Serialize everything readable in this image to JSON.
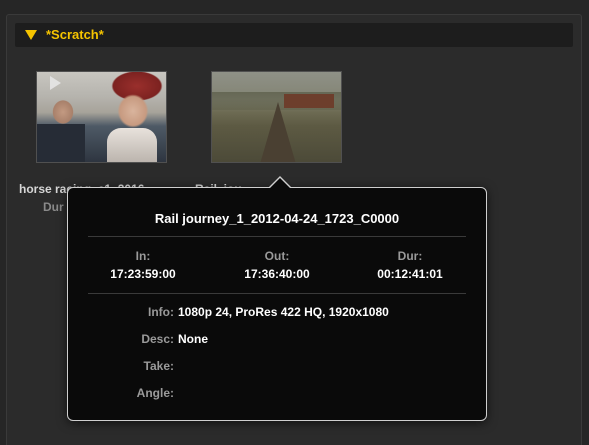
{
  "bin": {
    "title": "*Scratch*",
    "accent_color": "#f5c400",
    "disclosure_icon": "triangle-down-icon"
  },
  "clips": [
    {
      "name": "horse racing_c1_2016",
      "name_visible": "horse racing_c1_2016",
      "sub": "Dur",
      "has_play_icon": true
    },
    {
      "name": "Rail journey_1_2012",
      "name_visible": "Rail_jou",
      "sub": ""
    }
  ],
  "tooltip": {
    "title": "Rail journey_1_2012-04-24_1723_C0000",
    "in_label": "In:",
    "in_value": "17:23:59:00",
    "out_label": "Out:",
    "out_value": "17:36:40:00",
    "dur_label": "Dur:",
    "dur_value": "00:12:41:01",
    "info_label": "Info:",
    "info_value": "1080p 24, ProRes 422 HQ, 1920x1080",
    "desc_label": "Desc:",
    "desc_value": "None",
    "take_label": "Take:",
    "take_value": "",
    "angle_label": "Angle:",
    "angle_value": ""
  }
}
